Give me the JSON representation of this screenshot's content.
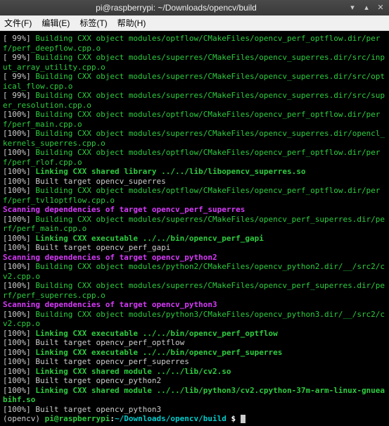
{
  "window": {
    "title": "pi@raspberrypi: ~/Downloads/opencv/build"
  },
  "menubar": {
    "file": "文件(F)",
    "edit": "编辑(E)",
    "tabs": "标签(T)",
    "help": "帮助(H)"
  },
  "lines": [
    {
      "c": "g",
      "p": "[ 99%] ",
      "t": "Building CXX object modules/optflow/CMakeFiles/opencv_perf_optflow.dir/perf/perf_deepflow.cpp.o"
    },
    {
      "c": "g",
      "p": "[ 99%] ",
      "t": "Building CXX object modules/superres/CMakeFiles/opencv_superres.dir/src/input_array_utility.cpp.o"
    },
    {
      "c": "g",
      "p": "[ 99%] ",
      "t": "Building CXX object modules/superres/CMakeFiles/opencv_superres.dir/src/optical_flow.cpp.o"
    },
    {
      "c": "g",
      "p": "[ 99%] ",
      "t": "Building CXX object modules/superres/CMakeFiles/opencv_superres.dir/src/super_resolution.cpp.o"
    },
    {
      "c": "g",
      "p": "[100%] ",
      "t": "Building CXX object modules/optflow/CMakeFiles/opencv_perf_optflow.dir/perf/perf_main.cpp.o"
    },
    {
      "c": "g",
      "p": "[100%] ",
      "t": "Building CXX object modules/superres/CMakeFiles/opencv_superres.dir/opencl_kernels_superres.cpp.o"
    },
    {
      "c": "g",
      "p": "[100%] ",
      "t": "Building CXX object modules/optflow/CMakeFiles/opencv_perf_optflow.dir/perf/perf_rlof.cpp.o"
    },
    {
      "c": "gb",
      "p": "[100%] ",
      "t": "Linking CXX shared library ../../lib/libopencv_superres.so"
    },
    {
      "c": "w",
      "p": "[100%] ",
      "t": "Built target opencv_superres"
    },
    {
      "c": "g",
      "p": "[100%] ",
      "t": "Building CXX object modules/optflow/CMakeFiles/opencv_perf_optflow.dir/perf/perf_tvl1optflow.cpp.o"
    },
    {
      "c": "m",
      "p": "",
      "t": "Scanning dependencies of target opencv_perf_superres"
    },
    {
      "c": "g",
      "p": "[100%] ",
      "t": "Building CXX object modules/superres/CMakeFiles/opencv_perf_superres.dir/perf/perf_main.cpp.o"
    },
    {
      "c": "gb",
      "p": "[100%] ",
      "t": "Linking CXX executable ../../bin/opencv_perf_gapi"
    },
    {
      "c": "w",
      "p": "[100%] ",
      "t": "Built target opencv_perf_gapi"
    },
    {
      "c": "m",
      "p": "",
      "t": "Scanning dependencies of target opencv_python2"
    },
    {
      "c": "g",
      "p": "[100%] ",
      "t": "Building CXX object modules/python2/CMakeFiles/opencv_python2.dir/__/src2/cv2.cpp.o"
    },
    {
      "c": "g",
      "p": "[100%] ",
      "t": "Building CXX object modules/superres/CMakeFiles/opencv_perf_superres.dir/perf/perf_superres.cpp.o"
    },
    {
      "c": "m",
      "p": "",
      "t": "Scanning dependencies of target opencv_python3"
    },
    {
      "c": "g",
      "p": "[100%] ",
      "t": "Building CXX object modules/python3/CMakeFiles/opencv_python3.dir/__/src2/cv2.cpp.o"
    },
    {
      "c": "gb",
      "p": "[100%] ",
      "t": "Linking CXX executable ../../bin/opencv_perf_optflow"
    },
    {
      "c": "w",
      "p": "[100%] ",
      "t": "Built target opencv_perf_optflow"
    },
    {
      "c": "gb",
      "p": "[100%] ",
      "t": "Linking CXX executable ../../bin/opencv_perf_superres"
    },
    {
      "c": "w",
      "p": "[100%] ",
      "t": "Built target opencv_perf_superres"
    },
    {
      "c": "gb",
      "p": "[100%] ",
      "t": "Linking CXX shared module ../../lib/cv2.so"
    },
    {
      "c": "w",
      "p": "[100%] ",
      "t": "Built target opencv_python2"
    },
    {
      "c": "gb",
      "p": "[100%] ",
      "t": "Linking CXX shared module ../../lib/python3/cv2.cpython-37m-arm-linux-gnueabihf.so"
    },
    {
      "c": "w",
      "p": "[100%] ",
      "t": "Built target opencv_python3"
    }
  ],
  "prompt": {
    "venv": "(opencv) ",
    "userhost": "pi@raspberrypi",
    "colon": ":",
    "path": "~/Downloads/opencv/build",
    "dollar": " $ "
  }
}
